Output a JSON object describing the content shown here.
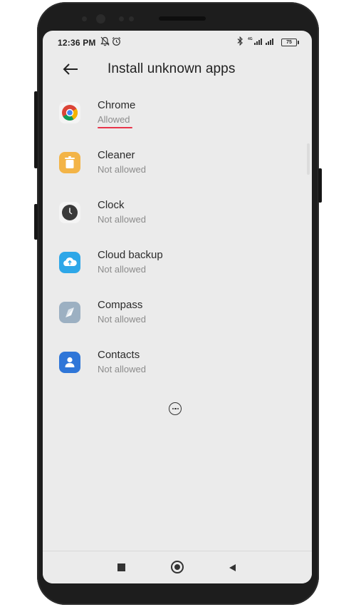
{
  "status_bar": {
    "time": "12:36 PM",
    "icons": [
      "mute-bell-icon",
      "alarm-icon",
      "bluetooth-icon",
      "signal-4g-icon",
      "signal-icon"
    ],
    "battery": "75"
  },
  "header": {
    "back_icon": "arrow-left-icon",
    "title": "Install unknown apps"
  },
  "apps": [
    {
      "name": "Chrome",
      "status": "Allowed",
      "icon": "chrome-icon"
    },
    {
      "name": "Cleaner",
      "status": "Not allowed",
      "icon": "trash-icon"
    },
    {
      "name": "Clock",
      "status": "Not allowed",
      "icon": "clock-icon"
    },
    {
      "name": "Cloud backup",
      "status": "Not allowed",
      "icon": "cloud-backup-icon"
    },
    {
      "name": "Compass",
      "status": "Not allowed",
      "icon": "compass-icon"
    },
    {
      "name": "Contacts",
      "status": "Not allowed",
      "icon": "contacts-icon"
    }
  ],
  "colors": {
    "accent_underline": "#e8354b",
    "background": "#ebebeb",
    "status_text": "#8c8c8c"
  },
  "nav_bar": [
    "recents-square-icon",
    "home-circle-icon",
    "back-triangle-icon"
  ]
}
